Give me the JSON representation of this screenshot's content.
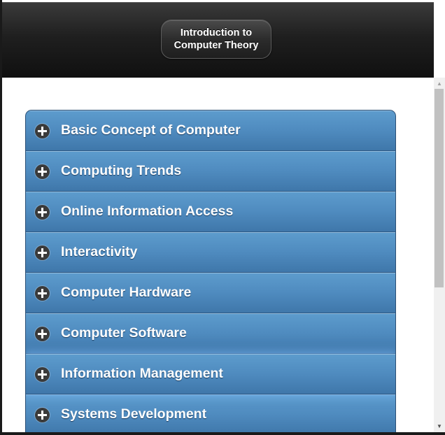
{
  "header": {
    "title": "Introduction to\nComputer Theory"
  },
  "accordion": {
    "items": [
      {
        "label": "Basic Concept of Computer"
      },
      {
        "label": "Computing Trends"
      },
      {
        "label": "Online Information Access"
      },
      {
        "label": "Interactivity"
      },
      {
        "label": "Computer Hardware"
      },
      {
        "label": "Computer Software"
      },
      {
        "label": "Information Management"
      },
      {
        "label": "Systems Development"
      }
    ]
  },
  "icons": {
    "expand": "plus-circle-icon",
    "scroll_up": "scroll-up-arrow-icon",
    "scroll_down": "scroll-down-arrow-icon"
  },
  "colors": {
    "header_bg": "#1f1f1f",
    "accordion_bg": "#4f8bbf",
    "accordion_text": "#ffffff",
    "icon_bg": "#3a3a3a"
  }
}
